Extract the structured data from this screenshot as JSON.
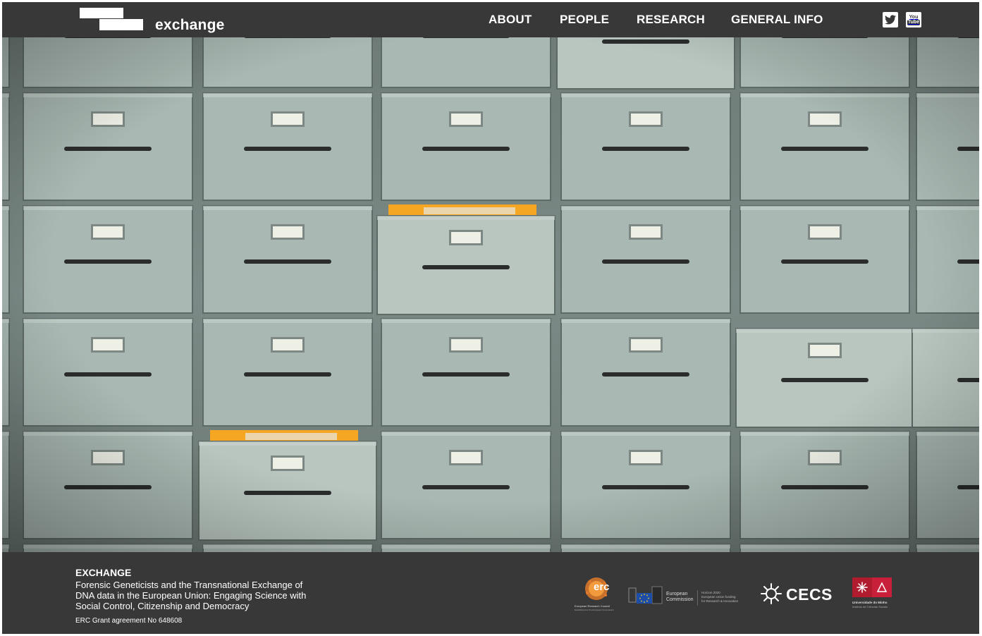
{
  "header": {
    "logo_text": "exchange",
    "nav": [
      "ABOUT",
      "PEOPLE",
      "RESEARCH",
      "GENERAL INFO"
    ],
    "social": {
      "twitter_icon": "twitter-icon",
      "youtube_icon": "youtube-icon",
      "youtube_label_top": "You",
      "youtube_label_bottom": "Tube"
    }
  },
  "hero": {
    "image": "filing-cabinet-drawers-photo",
    "colors": {
      "drawer": "#a9b8b2",
      "handle": "#2a2d2c",
      "folder": "#f5a623"
    }
  },
  "footer": {
    "title": "EXCHANGE",
    "description": "Forensic Geneticists and the Transnational Exchange of DNA data in the European Union: Engaging Science with Social Control, Citizenship and Democracy",
    "grant": "ERC Grant agreement No 648608",
    "partners": {
      "erc": {
        "mark": "erc",
        "name": "European Research Council",
        "sub": "Established by the European Commission"
      },
      "ec": {
        "name_line1": "European",
        "name_line2": "Commission",
        "h2020_line1": "Horizon 2020",
        "h2020_line2": "European Union funding",
        "h2020_line3": "for Research & Innovation"
      },
      "cecs": {
        "name": "CECS"
      },
      "uminho": {
        "name": "Universidade do Minho",
        "sub": "Instituto de Ciências Sociais"
      }
    }
  }
}
